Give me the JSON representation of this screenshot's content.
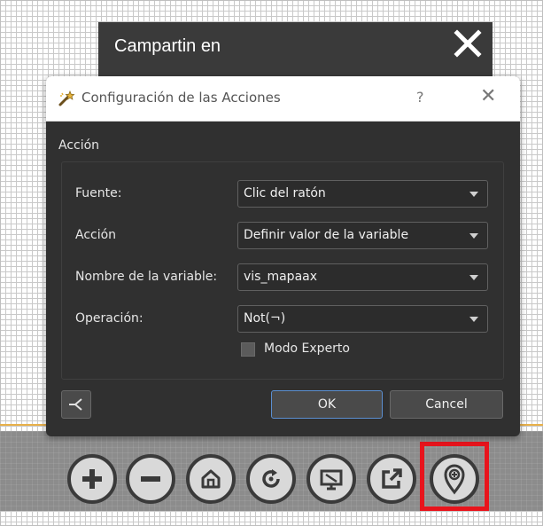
{
  "share_bar": {
    "title": "Campartin en",
    "close_icon": "close-x-icon"
  },
  "dialog": {
    "title": "Configuración de las Acciones",
    "help_label": "?",
    "close_label": "✕",
    "section_label": "Acción",
    "fields": [
      {
        "label": "Fuente:",
        "value": "Clic del ratón"
      },
      {
        "label": "Acción",
        "value": "Definir valor de la variable"
      },
      {
        "label": "Nombre de la variable:",
        "value": "vis_mapaax"
      },
      {
        "label": "Operación:",
        "value": "Not(¬)"
      }
    ],
    "expert_mode_label": "Modo Experto",
    "expert_mode_checked": false,
    "ok_label": "OK",
    "cancel_label": "Cancel"
  },
  "toolbar": {
    "buttons": [
      "zoom-in-icon",
      "zoom-out-icon",
      "home-icon",
      "refresh-icon",
      "screen-icon",
      "external-link-icon",
      "location-pin-icon"
    ],
    "highlight_color": "#e8141c"
  }
}
